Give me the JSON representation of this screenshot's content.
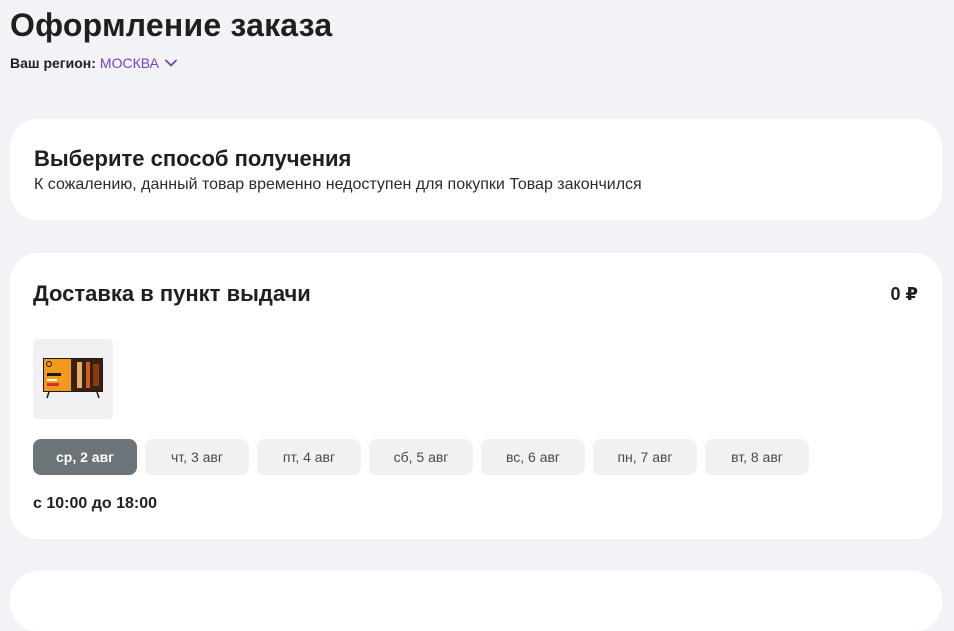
{
  "header": {
    "title": "Оформление заказа",
    "region_label": "Ваш регион:",
    "region_value": "МОСКВА"
  },
  "pickup_method": {
    "title": "Выберите способ получения",
    "message": "К сожалению, данный товар временно недоступен для покупки Товар закончился"
  },
  "delivery": {
    "title": "Доставка в пункт выдачи",
    "price": "0 ₽",
    "dates": [
      {
        "label": "ср, 2 авг",
        "active": true
      },
      {
        "label": "чт, 3 авг",
        "active": false
      },
      {
        "label": "пт, 4 авг",
        "active": false
      },
      {
        "label": "сб, 5 авг",
        "active": false
      },
      {
        "label": "вс, 6 авг",
        "active": false
      },
      {
        "label": "пн, 7 авг",
        "active": false
      },
      {
        "label": "вт, 8 авг",
        "active": false
      }
    ],
    "time": "с 10:00 до 18:00"
  },
  "colors": {
    "accent": "#7b3fbf",
    "active_chip": "#6a7479",
    "background": "#f2f3f7"
  }
}
